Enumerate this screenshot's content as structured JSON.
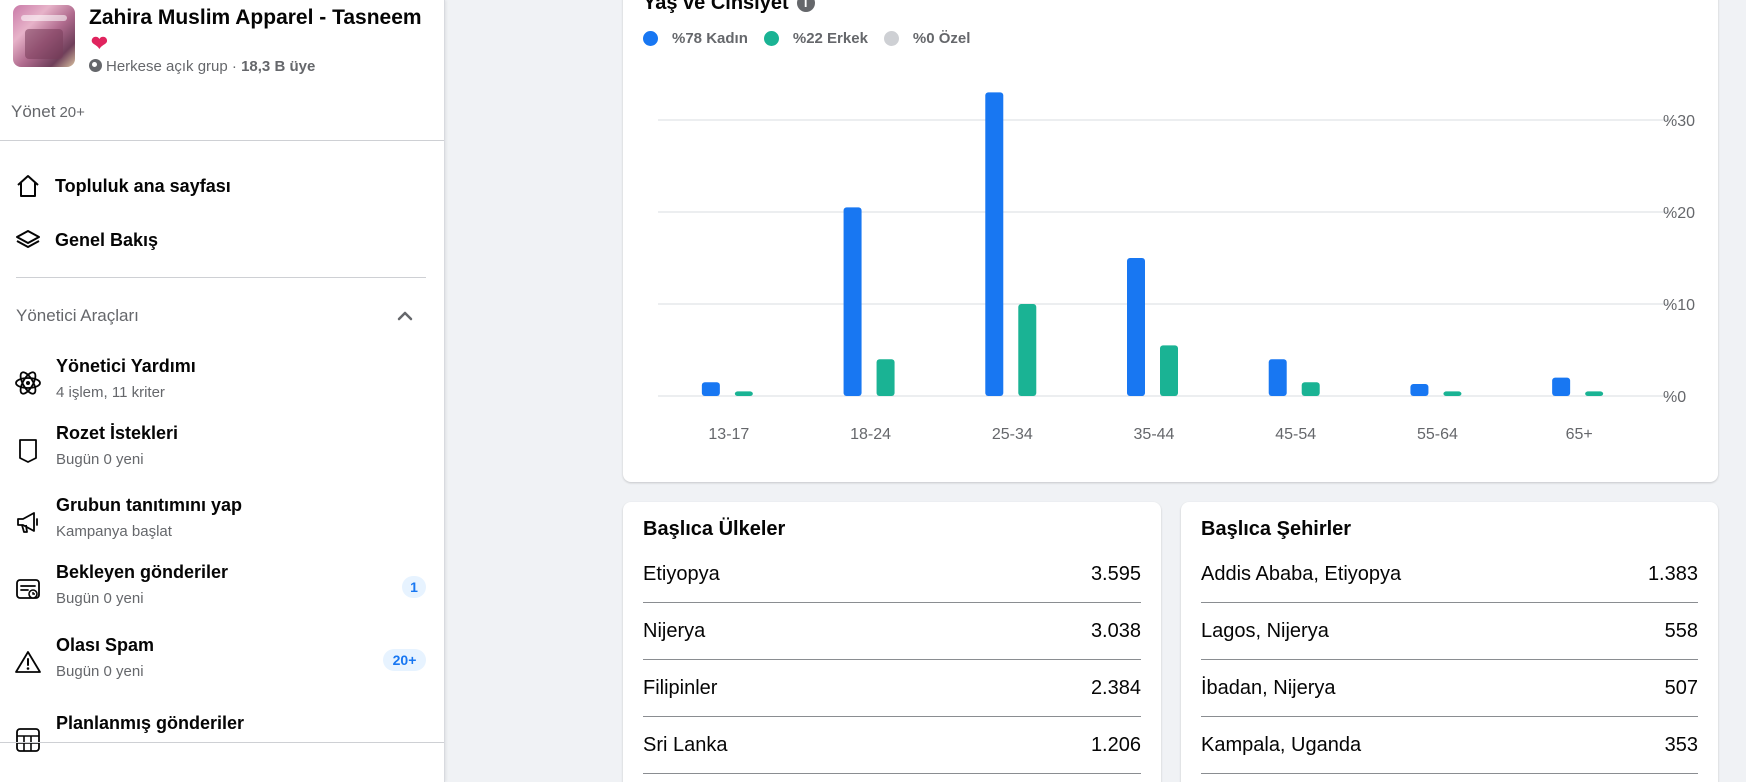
{
  "group": {
    "name": "Zahira Muslim Apparel - Tasneem",
    "heart": "❤",
    "privacy": "Herkese açık grup",
    "separator": " · ",
    "members": "18,3 B üye"
  },
  "manage": {
    "label": "Yönet",
    "count": "20+"
  },
  "nav": [
    {
      "label": "Topluluk ana sayfası",
      "icon": "home-icon"
    },
    {
      "label": "Genel Bakış",
      "icon": "layers-icon"
    }
  ],
  "admin_tools": {
    "header": "Yönetici Araçları",
    "items": [
      {
        "title": "Yönetici Yardımı",
        "subtitle": "4 işlem, 11 kriter",
        "icon": "atom-icon",
        "badge": ""
      },
      {
        "title": "Rozet İstekleri",
        "subtitle": "Bugün 0 yeni",
        "icon": "badge-icon",
        "badge": ""
      },
      {
        "title": "Grubun tanıtımını yap",
        "subtitle": "Kampanya başlat",
        "icon": "megaphone-icon",
        "badge": ""
      },
      {
        "title": "Bekleyen gönderiler",
        "subtitle": "Bugün 0 yeni",
        "icon": "pending-posts-icon",
        "badge": "1"
      },
      {
        "title": "Olası Spam",
        "subtitle": "Bugün 0 yeni",
        "icon": "warning-icon",
        "badge": "20+"
      },
      {
        "title": "Planlanmış gönderiler",
        "subtitle": "",
        "icon": "calendar-grid-icon",
        "badge": ""
      }
    ]
  },
  "chart_data": {
    "type": "bar",
    "title": "Yaş ve Cinsiyet",
    "legend": [
      "%78 Kadın",
      "%22 Erkek",
      "%0 Özel"
    ],
    "categories": [
      "13-17",
      "18-24",
      "25-34",
      "35-44",
      "45-54",
      "55-64",
      "65+"
    ],
    "series": [
      {
        "name": "Kadın",
        "color": "#1877f2",
        "values": [
          1.5,
          20.5,
          33,
          15,
          4,
          1.3,
          2
        ]
      },
      {
        "name": "Erkek",
        "color": "#1ab394",
        "values": [
          0.5,
          4,
          10,
          5.5,
          1.5,
          0.5,
          0.5
        ]
      },
      {
        "name": "Özel",
        "color": "#ced0d4",
        "values": [
          0,
          0,
          0,
          0,
          0,
          0,
          0
        ]
      }
    ],
    "y_ticks": [
      "%0",
      "%10",
      "%20",
      "%30"
    ],
    "ylim": [
      0,
      33
    ],
    "y_axis_side": "right",
    "grid": true,
    "legend_position": "top-left"
  },
  "countries": {
    "title": "Başlıca Ülkeler",
    "rows": [
      {
        "name": "Etiyopya",
        "value": "3.595"
      },
      {
        "name": "Nijerya",
        "value": "3.038"
      },
      {
        "name": "Filipinler",
        "value": "2.384"
      },
      {
        "name": "Sri Lanka",
        "value": "1.206"
      }
    ]
  },
  "cities": {
    "title": "Başlıca Şehirler",
    "rows": [
      {
        "name": "Addis Ababa, Etiyopya",
        "value": "1.383"
      },
      {
        "name": "Lagos, Nijerya",
        "value": "558"
      },
      {
        "name": "İbadan, Nijerya",
        "value": "507"
      },
      {
        "name": "Kampala, Uganda",
        "value": "353"
      }
    ]
  },
  "colors": {
    "accent": "#1877f2",
    "secondary": "#1ab394",
    "muted": "#65676b"
  }
}
